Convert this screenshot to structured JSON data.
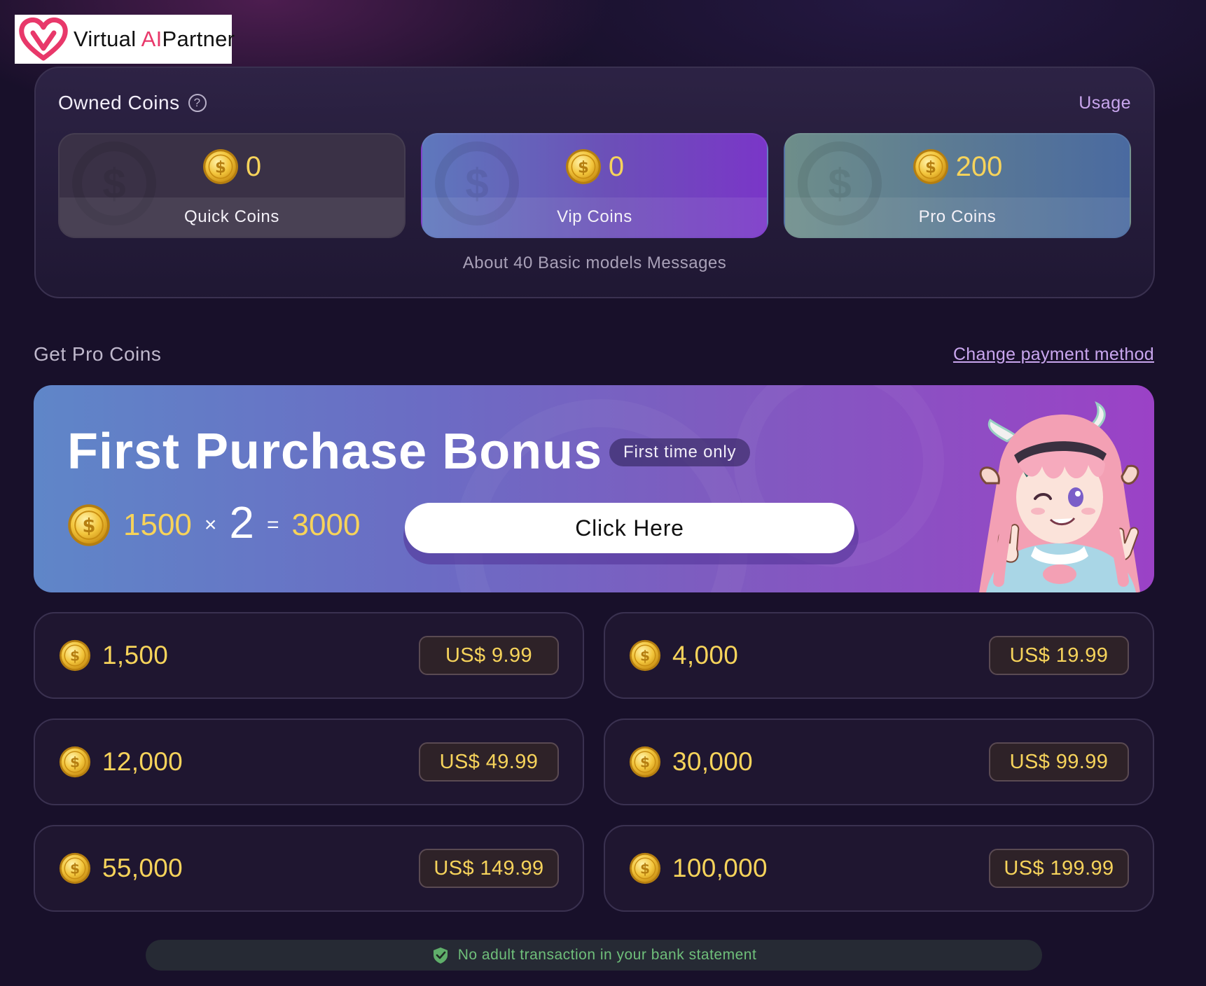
{
  "brand": {
    "name_prefix": "Virtual",
    "name_ai": "AI",
    "name_suffix": "Partner",
    "heart_color": "#e8386a"
  },
  "owned": {
    "title": "Owned Coins",
    "help_symbol": "?",
    "usage_label": "Usage",
    "cards": [
      {
        "amount": "0",
        "label": "Quick Coins"
      },
      {
        "amount": "0",
        "label": "Vip Coins"
      },
      {
        "amount": "200",
        "label": "Pro Coins"
      }
    ],
    "note": "About 40 Basic models Messages"
  },
  "get_coins": {
    "title": "Get Pro Coins",
    "change_payment_label": "Change payment method"
  },
  "bonus": {
    "title": "First Purchase Bonus",
    "badge": "First time only",
    "base": "1500",
    "times": "×",
    "multiplier": "2",
    "equals": "=",
    "result": "3000",
    "cta_label": "Click Here"
  },
  "packages": [
    {
      "amount": "1,500",
      "price": "US$ 9.99"
    },
    {
      "amount": "4,000",
      "price": "US$ 19.99"
    },
    {
      "amount": "12,000",
      "price": "US$ 49.99"
    },
    {
      "amount": "30,000",
      "price": "US$ 99.99"
    },
    {
      "amount": "55,000",
      "price": "US$ 149.99"
    },
    {
      "amount": "100,000",
      "price": "US$ 199.99"
    }
  ],
  "notice": {
    "text": "No adult transaction in your bank statement",
    "icon": "shield-check-icon"
  },
  "colors": {
    "background": "#18102a",
    "gold": "#f6d35b",
    "link": "#c9a6ee",
    "notice_green": "#6fbf7a"
  }
}
